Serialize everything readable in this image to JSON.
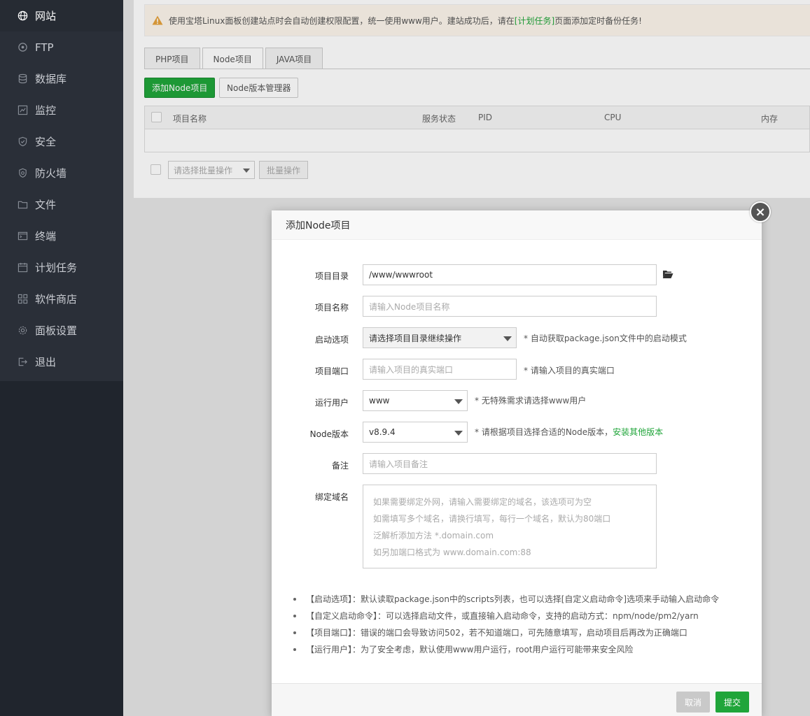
{
  "sidebar": {
    "items": [
      {
        "label": "网站",
        "icon": "globe-icon"
      },
      {
        "label": "FTP",
        "icon": "ftp-icon"
      },
      {
        "label": "数据库",
        "icon": "database-icon"
      },
      {
        "label": "监控",
        "icon": "monitor-icon"
      },
      {
        "label": "安全",
        "icon": "shield-icon"
      },
      {
        "label": "防火墙",
        "icon": "firewall-icon"
      },
      {
        "label": "文件",
        "icon": "folder-icon"
      },
      {
        "label": "终端",
        "icon": "terminal-icon"
      },
      {
        "label": "计划任务",
        "icon": "calendar-icon"
      },
      {
        "label": "软件商店",
        "icon": "grid-icon"
      },
      {
        "label": "面板设置",
        "icon": "gear-icon"
      },
      {
        "label": "退出",
        "icon": "logout-icon"
      }
    ]
  },
  "notice": {
    "text_before": "使用宝塔Linux面板创建站点时会自动创建权限配置，统一使用www用户。建站成功后，请在",
    "link": "[计划任务]",
    "text_after": "页面添加定时备份任务!"
  },
  "tabs": [
    "PHP项目",
    "Node项目",
    "JAVA项目"
  ],
  "toolbar": {
    "add_label": "添加Node项目",
    "version_label": "Node版本管理器"
  },
  "table": {
    "columns": [
      "项目名称",
      "服务状态",
      "PID",
      "CPU",
      "内存"
    ]
  },
  "batch": {
    "select_placeholder": "请选择批量操作",
    "button": "批量操作"
  },
  "modal": {
    "title": "添加Node项目",
    "close": "×",
    "fields": {
      "dir": {
        "label": "项目目录",
        "value": "/www/wwwroot"
      },
      "name": {
        "label": "项目名称",
        "placeholder": "请输入Node项目名称"
      },
      "start": {
        "label": "启动选项",
        "value": "请选择项目目录继续操作",
        "hint": "* 自动获取package.json文件中的启动模式"
      },
      "port": {
        "label": "项目端口",
        "placeholder": "请输入项目的真实端口",
        "hint": "* 请输入项目的真实端口"
      },
      "user": {
        "label": "运行用户",
        "value": "www",
        "hint": "* 无特殊需求请选择www用户"
      },
      "node": {
        "label": "Node版本",
        "value": "v8.9.4",
        "hint": "* 请根据项目选择合适的Node版本，",
        "hint_link": "安装其他版本"
      },
      "remark": {
        "label": "备注",
        "placeholder": "请输入项目备注"
      },
      "domain": {
        "label": "绑定域名",
        "placeholder_lines": [
          "如果需要绑定外网，请输入需要绑定的域名，该选项可为空",
          "如需填写多个域名，请换行填写，每行一个域名，默认为80端口",
          "泛解析添加方法 *.domain.com",
          "如另加端口格式为 www.domain.com:88"
        ]
      }
    },
    "tips": [
      "【启动选项】：默认读取package.json中的scripts列表，也可以选择[自定义启动命令]选项来手动输入启动命令",
      "【自定义启动命令】：可以选择启动文件，或直接输入启动命令，支持的启动方式：npm/node/pm2/yarn",
      "【项目端口】：错误的端口会导致访问502，若不知道端口，可先随意填写，启动项目后再改为正确端口",
      "【运行用户】：为了安全考虑，默认使用www用户运行，root用户运行可能带来安全风险"
    ],
    "cancel": "取消",
    "submit": "提交"
  },
  "colors": {
    "accent": "#20a53a",
    "sidebar": "#2a2f38"
  }
}
